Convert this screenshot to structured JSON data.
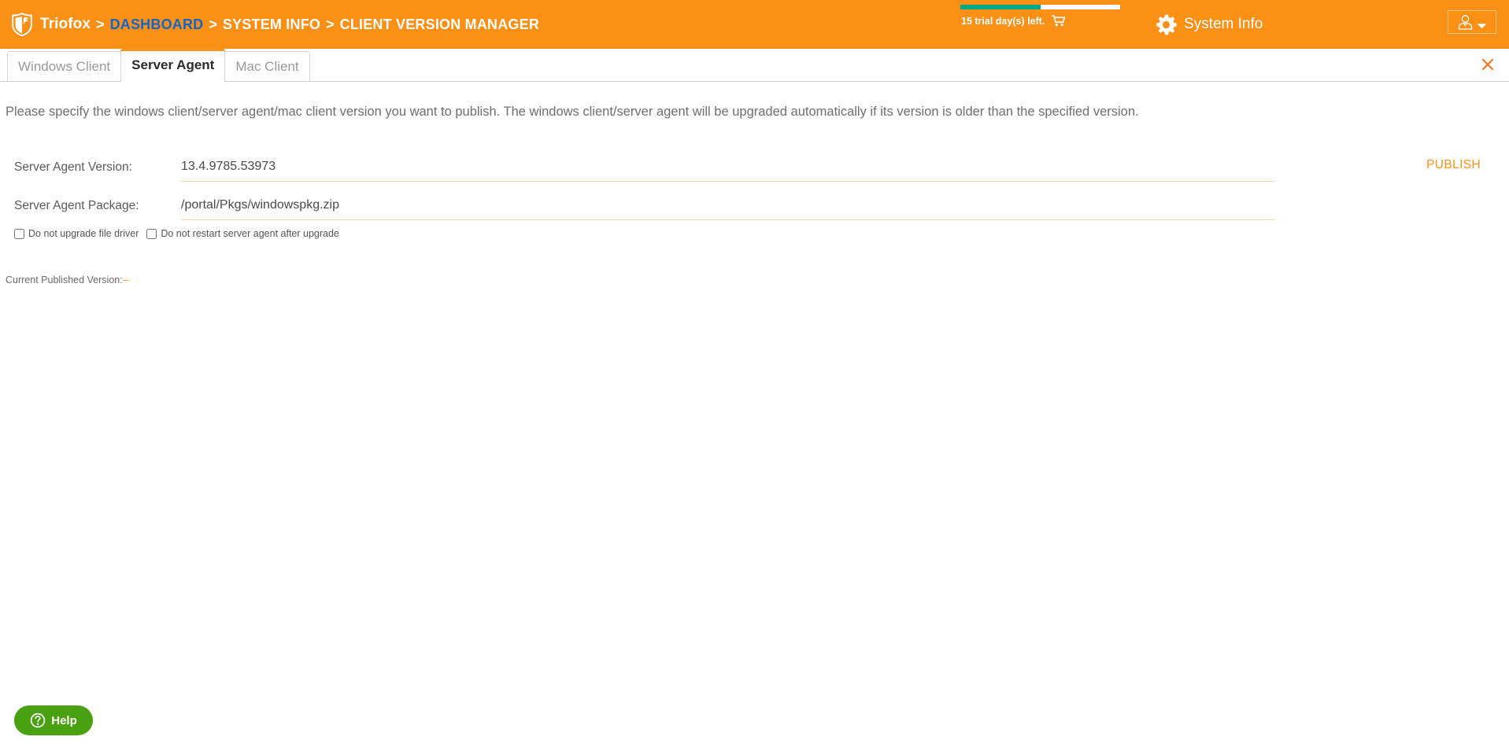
{
  "header": {
    "brand": "Triofox",
    "separator": ">",
    "breadcrumbs": [
      {
        "label": "DASHBOARD",
        "accent": true
      },
      {
        "label": "SYSTEM INFO",
        "accent": false
      },
      {
        "label": "CLIENT VERSION MANAGER",
        "accent": false
      }
    ],
    "trial": {
      "text": "15 trial day(s) left.",
      "progress_percent": 50,
      "fill_color": "#00A887",
      "track_color": "#FFFFFF",
      "cart_icon": "shopping-cart-icon"
    },
    "system_info_label": "System Info",
    "gear_icon": "gear-icon",
    "logo_icon": "triofox-shield-logo-icon",
    "user_menu": {
      "avatar_icon": "user-avatar-icon",
      "chevron_icon": "chevron-down-icon"
    },
    "background_color": "#FA9016",
    "accent_link_color": "#1565C8"
  },
  "tabs": {
    "items": [
      {
        "label": "Windows Client",
        "active": false
      },
      {
        "label": "Server Agent",
        "active": true
      },
      {
        "label": "Mac Client",
        "active": false
      }
    ],
    "active_indicator_color": "#F7941E",
    "close_icon": "close-icon"
  },
  "main": {
    "intro": "Please specify the windows client/server agent/mac client version you want to publish. The windows client/server agent will be upgraded automatically if its version is older than the specified version.",
    "fields": [
      {
        "label": "Server Agent Version:",
        "value": "13.4.9785.53973",
        "placeholder": ""
      },
      {
        "label": "Server Agent Package:",
        "value": "/portal/Pkgs/windowspkg.zip",
        "placeholder": ""
      }
    ],
    "publish_label": "PUBLISH",
    "checkboxes": [
      {
        "label": "Do not upgrade file driver",
        "checked": false
      },
      {
        "label": "Do not restart server agent after upgrade",
        "checked": false
      }
    ],
    "published_label": "Current Published Version:",
    "published_value": "--",
    "underline_color": "#FAD7A8"
  },
  "help": {
    "label": "Help",
    "icon": "question-circle-icon",
    "background_color": "#49A010"
  }
}
